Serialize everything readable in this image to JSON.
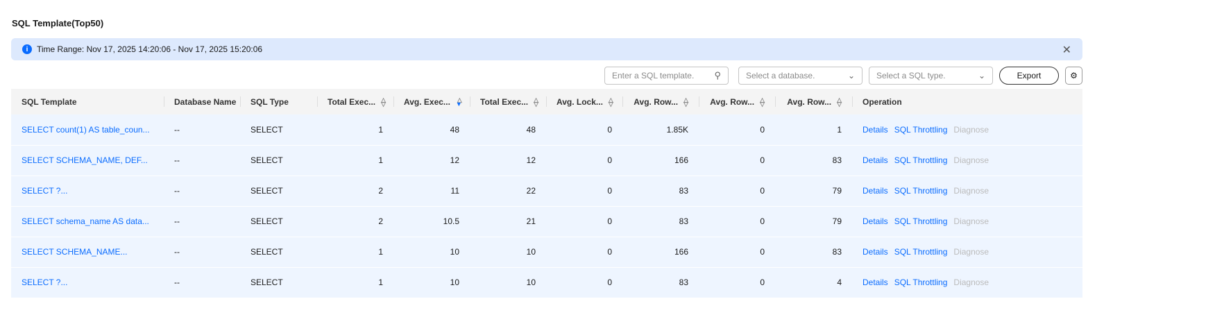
{
  "title": "SQL Template(Top50)",
  "alert": {
    "text": "Time Range: Nov 17, 2025 14:20:06 - Nov 17, 2025 15:20:06"
  },
  "toolbar": {
    "search_placeholder": "Enter a SQL template.",
    "database_placeholder": "Select a database.",
    "type_placeholder": "Select a SQL type.",
    "export_label": "Export"
  },
  "columns": [
    "SQL Template",
    "Database Name",
    "SQL Type",
    "Total Exec...",
    "Avg. Exec...",
    "Total Exec...",
    "Avg. Lock...",
    "Avg. Row...",
    "Avg. Row...",
    "Avg. Row...",
    "Operation"
  ],
  "operations": {
    "details": "Details",
    "throttling": "SQL Throttling",
    "diagnose": "Diagnose"
  },
  "rows": [
    [
      "SELECT count(1) AS table_coun...",
      "--",
      "SELECT",
      "1",
      "48",
      "48",
      "0",
      "1.85K",
      "0",
      "1"
    ],
    [
      "SELECT SCHEMA_NAME, DEF...",
      "--",
      "SELECT",
      "1",
      "12",
      "12",
      "0",
      "166",
      "0",
      "83"
    ],
    [
      "SELECT ?...",
      "--",
      "SELECT",
      "2",
      "11",
      "22",
      "0",
      "83",
      "0",
      "79"
    ],
    [
      "SELECT schema_name AS data...",
      "--",
      "SELECT",
      "2",
      "10.5",
      "21",
      "0",
      "83",
      "0",
      "79"
    ],
    [
      "SELECT SCHEMA_NAME...",
      "--",
      "SELECT",
      "1",
      "10",
      "10",
      "0",
      "166",
      "0",
      "83"
    ],
    [
      "SELECT ?...",
      "--",
      "SELECT",
      "1",
      "10",
      "10",
      "0",
      "83",
      "0",
      "4"
    ]
  ]
}
